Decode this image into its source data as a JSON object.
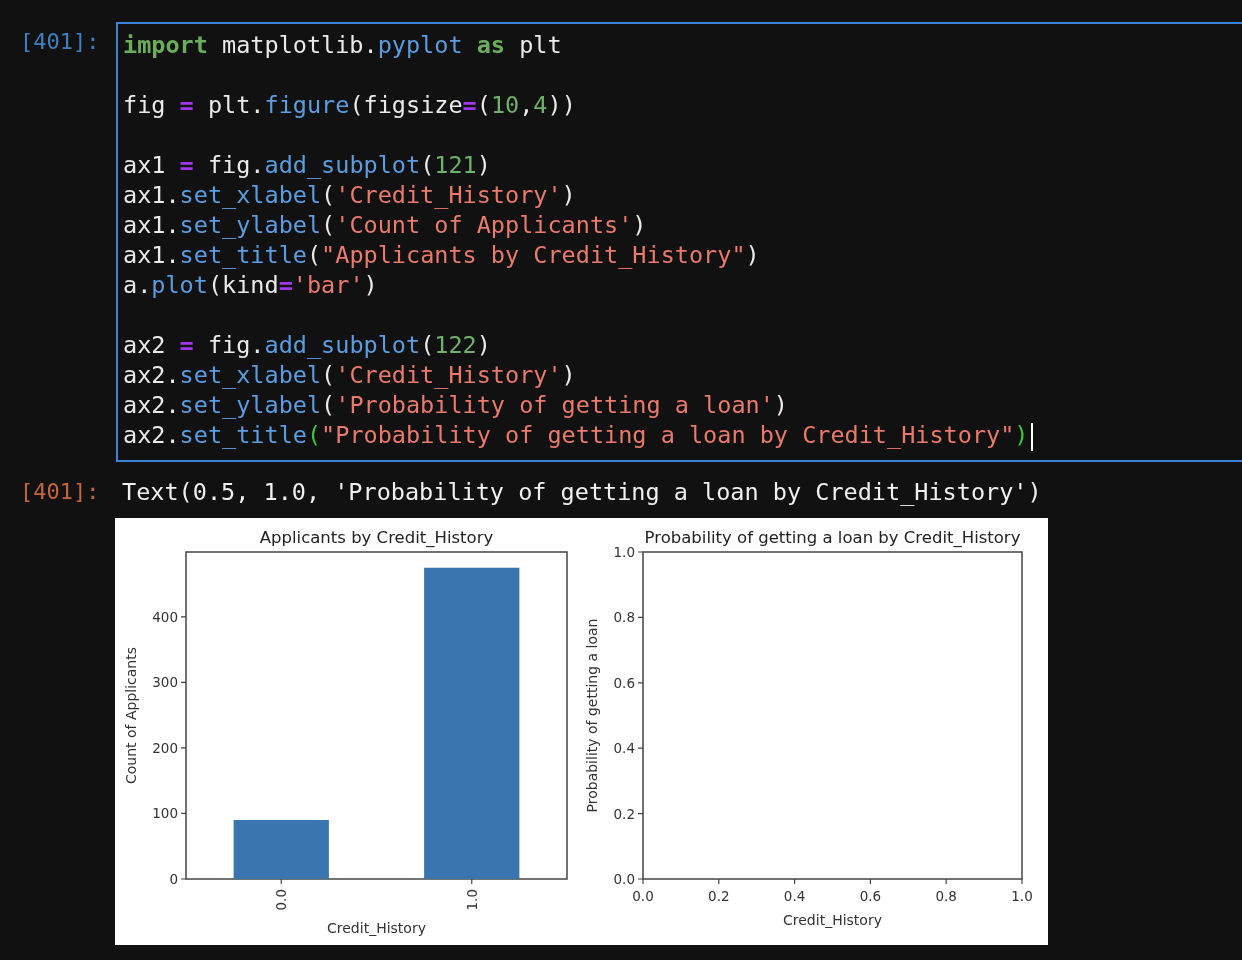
{
  "input_cell": {
    "prompt": "[401]:",
    "cursor_at_end": true,
    "blocks": [
      [
        [
          {
            "text": "import",
            "kind": "keyword"
          },
          {
            "text": " matplotlib.",
            "kind": "plain"
          },
          {
            "text": "pyplot ",
            "kind": "attr"
          },
          {
            "text": "as",
            "kind": "keyword"
          },
          {
            "text": " plt",
            "kind": "plain"
          }
        ]
      ],
      [
        [
          {
            "text": "fig ",
            "kind": "plain"
          },
          {
            "text": "=",
            "kind": "op"
          },
          {
            "text": " plt.",
            "kind": "plain"
          },
          {
            "text": "figure",
            "kind": "attr"
          },
          {
            "text": "(figsize",
            "kind": "plain"
          },
          {
            "text": "=",
            "kind": "op"
          },
          {
            "text": "(",
            "kind": "plain"
          },
          {
            "text": "10",
            "kind": "number"
          },
          {
            "text": ",",
            "kind": "plain"
          },
          {
            "text": "4",
            "kind": "number"
          },
          {
            "text": "))",
            "kind": "plain"
          }
        ]
      ],
      [
        [
          {
            "text": "ax1 ",
            "kind": "plain"
          },
          {
            "text": "=",
            "kind": "op"
          },
          {
            "text": " fig.",
            "kind": "plain"
          },
          {
            "text": "add_subplot",
            "kind": "attr"
          },
          {
            "text": "(",
            "kind": "plain"
          },
          {
            "text": "121",
            "kind": "number"
          },
          {
            "text": ")",
            "kind": "plain"
          }
        ],
        [
          {
            "text": "ax1.",
            "kind": "plain"
          },
          {
            "text": "set_xlabel",
            "kind": "attr"
          },
          {
            "text": "(",
            "kind": "plain"
          },
          {
            "text": "'Credit_History'",
            "kind": "string"
          },
          {
            "text": ")",
            "kind": "plain"
          }
        ],
        [
          {
            "text": "ax1.",
            "kind": "plain"
          },
          {
            "text": "set_ylabel",
            "kind": "attr"
          },
          {
            "text": "(",
            "kind": "plain"
          },
          {
            "text": "'Count of Applicants'",
            "kind": "string"
          },
          {
            "text": ")",
            "kind": "plain"
          }
        ],
        [
          {
            "text": "ax1.",
            "kind": "plain"
          },
          {
            "text": "set_title",
            "kind": "attr"
          },
          {
            "text": "(",
            "kind": "plain"
          },
          {
            "text": "\"Applicants by Credit_History\"",
            "kind": "string"
          },
          {
            "text": ")",
            "kind": "plain"
          }
        ],
        [
          {
            "text": "a.",
            "kind": "plain"
          },
          {
            "text": "plot",
            "kind": "attr"
          },
          {
            "text": "(kind",
            "kind": "plain"
          },
          {
            "text": "=",
            "kind": "op"
          },
          {
            "text": "'bar'",
            "kind": "string"
          },
          {
            "text": ")",
            "kind": "plain"
          }
        ]
      ],
      [
        [
          {
            "text": "ax2 ",
            "kind": "plain"
          },
          {
            "text": "=",
            "kind": "op"
          },
          {
            "text": " fig.",
            "kind": "plain"
          },
          {
            "text": "add_subplot",
            "kind": "attr"
          },
          {
            "text": "(",
            "kind": "plain"
          },
          {
            "text": "122",
            "kind": "number"
          },
          {
            "text": ")",
            "kind": "plain"
          }
        ],
        [
          {
            "text": "ax2.",
            "kind": "plain"
          },
          {
            "text": "set_xlabel",
            "kind": "attr"
          },
          {
            "text": "(",
            "kind": "plain"
          },
          {
            "text": "'Credit_History'",
            "kind": "string"
          },
          {
            "text": ")",
            "kind": "plain"
          }
        ],
        [
          {
            "text": "ax2.",
            "kind": "plain"
          },
          {
            "text": "set_ylabel",
            "kind": "attr"
          },
          {
            "text": "(",
            "kind": "plain"
          },
          {
            "text": "'Probability of getting a loan'",
            "kind": "string"
          },
          {
            "text": ")",
            "kind": "plain"
          }
        ],
        [
          {
            "text": "ax2.",
            "kind": "plain"
          },
          {
            "text": "set_title",
            "kind": "attr"
          },
          {
            "text": "(",
            "kind": "match"
          },
          {
            "text": "\"Probability of getting a loan by Credit_History\"",
            "kind": "string"
          },
          {
            "text": ")",
            "kind": "match"
          }
        ]
      ]
    ]
  },
  "output_cell": {
    "prompt": "[401]:",
    "text": "Text(0.5, 1.0, 'Probability of getting a loan by Credit_History')",
    "figure": [
      {
        "chart_data": {
          "type": "bar",
          "title": "Applicants by Credit_History",
          "xlabel": "Credit_History",
          "ylabel": "Count of Applicants",
          "categories": [
            "0.0",
            "1.0"
          ],
          "values": [
            90,
            475
          ],
          "ylim": [
            0,
            499
          ],
          "yticks": [
            0,
            100,
            200,
            300,
            400
          ]
        }
      },
      {
        "chart_data": {
          "type": "line",
          "title": "Probability of getting a loan by Credit_History",
          "xlabel": "Credit_History",
          "ylabel": "Probability of getting a loan",
          "xlim": [
            0,
            1
          ],
          "ylim": [
            0,
            1
          ],
          "xticks": [
            {
              "value": 0,
              "label": "0.0"
            },
            {
              "value": 0.2,
              "label": "0.2"
            },
            {
              "value": 0.4,
              "label": "0.4"
            },
            {
              "value": 0.6,
              "label": "0.6"
            },
            {
              "value": 0.8,
              "label": "0.8"
            },
            {
              "value": 1,
              "label": "1.0"
            }
          ],
          "yticks": [
            {
              "value": 0,
              "label": "0.0"
            },
            {
              "value": 0.2,
              "label": "0.2"
            },
            {
              "value": 0.4,
              "label": "0.4"
            },
            {
              "value": 0.6,
              "label": "0.6"
            },
            {
              "value": 0.8,
              "label": "0.8"
            },
            {
              "value": 1,
              "label": "1.0"
            }
          ]
        }
      }
    ]
  }
}
